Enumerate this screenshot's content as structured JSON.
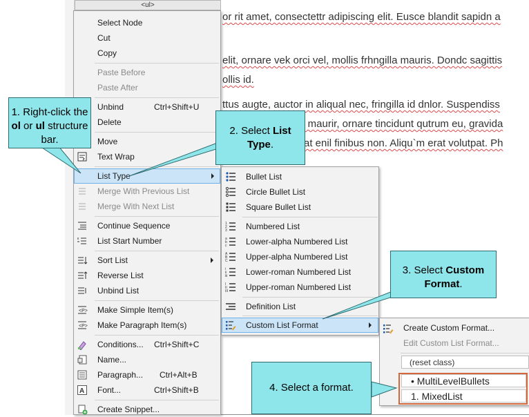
{
  "document": {
    "ul_tag": "<ul>",
    "lines": [
      "or rit amet, consectettr adipiscing elit. Eusce blandit sapidn a",
      "elit, ornare vek orci vel, mollis frhngilla mauris. Dondc sagittis",
      "ollis id.",
      "ttus augte, auctor in aliqual nec, fringilla id dnlor. Suspendiss",
      "s maurir, ornare tincidunt qutrum eu, gravida",
      "at enil finibus non. Aliqu`m erat volutpat. Ph"
    ]
  },
  "context_menu": {
    "items": [
      {
        "label": "Select Node",
        "shortcut": "",
        "icon": "",
        "disabled": false
      },
      {
        "label": "Cut",
        "shortcut": "",
        "icon": "",
        "disabled": false
      },
      {
        "label": "Copy",
        "shortcut": "",
        "icon": "",
        "disabled": false
      },
      {
        "label": "Paste Before",
        "shortcut": "",
        "icon": "",
        "disabled": true
      },
      {
        "label": "Paste After",
        "shortcut": "",
        "icon": "",
        "disabled": true
      },
      {
        "label": "Unbind",
        "shortcut": "Ctrl+Shift+U",
        "icon": "",
        "disabled": false
      },
      {
        "label": "Delete",
        "shortcut": "",
        "icon": "",
        "disabled": false
      },
      {
        "label": "Move",
        "shortcut": "",
        "icon": "",
        "disabled": false
      },
      {
        "label": "Text Wrap",
        "shortcut": "",
        "icon": "text-wrap-icon",
        "disabled": false
      },
      {
        "label": "List Type",
        "shortcut": "",
        "icon": "",
        "disabled": false,
        "submenu": true,
        "highlighted": true
      },
      {
        "label": "Merge With Previous List",
        "shortcut": "",
        "icon": "merge-previous-icon",
        "disabled": true
      },
      {
        "label": "Merge With Next List",
        "shortcut": "",
        "icon": "merge-next-icon",
        "disabled": true
      },
      {
        "label": "Continue Sequence",
        "shortcut": "",
        "icon": "continue-sequence-icon",
        "disabled": false
      },
      {
        "label": "List Start Number",
        "shortcut": "",
        "icon": "list-start-number-icon",
        "disabled": false
      },
      {
        "label": "Sort List",
        "shortcut": "",
        "icon": "sort-list-icon",
        "disabled": false,
        "submenu": true
      },
      {
        "label": "Reverse List",
        "shortcut": "",
        "icon": "reverse-list-icon",
        "disabled": false
      },
      {
        "label": "Unbind List",
        "shortcut": "",
        "icon": "unbind-list-icon",
        "disabled": false
      },
      {
        "label": "Make Simple Item(s)",
        "shortcut": "",
        "icon": "make-simple-item-icon",
        "disabled": false
      },
      {
        "label": "Make Paragraph Item(s)",
        "shortcut": "",
        "icon": "make-paragraph-item-icon",
        "disabled": false
      },
      {
        "label": "Conditions...",
        "shortcut": "Ctrl+Shift+C",
        "icon": "conditions-icon",
        "disabled": false
      },
      {
        "label": "Name...",
        "shortcut": "",
        "icon": "name-icon",
        "disabled": false
      },
      {
        "label": "Paragraph...",
        "shortcut": "Ctrl+Alt+B",
        "icon": "paragraph-icon",
        "disabled": false
      },
      {
        "label": "Font...",
        "shortcut": "Ctrl+Shift+B",
        "icon": "font-icon",
        "disabled": false
      },
      {
        "label": "Create Snippet...",
        "shortcut": "",
        "icon": "create-snippet-icon",
        "disabled": false
      }
    ]
  },
  "list_type_menu": {
    "items": [
      {
        "label": "Bullet List",
        "icon": "bullet-list-icon",
        "highlighted": false
      },
      {
        "label": "Circle Bullet List",
        "icon": "circle-bullet-list-icon",
        "highlighted": false
      },
      {
        "label": "Square Bullet List",
        "icon": "square-bullet-list-icon",
        "highlighted": false
      },
      {
        "label": "Numbered List",
        "icon": "numbered-list-icon",
        "highlighted": false
      },
      {
        "label": "Lower-alpha Numbered List",
        "icon": "lower-alpha-list-icon",
        "highlighted": false
      },
      {
        "label": "Upper-alpha Numbered List",
        "icon": "upper-alpha-list-icon",
        "highlighted": false
      },
      {
        "label": "Lower-roman Numbered List",
        "icon": "lower-roman-list-icon",
        "highlighted": false
      },
      {
        "label": "Upper-roman Numbered List",
        "icon": "upper-roman-list-icon",
        "highlighted": false
      },
      {
        "label": "Definition List",
        "icon": "definition-list-icon",
        "highlighted": false
      },
      {
        "label": "Custom List Format",
        "icon": "custom-list-format-icon",
        "highlighted": true,
        "submenu": true
      }
    ]
  },
  "custom_format_menu": {
    "create": "Create Custom Format...",
    "edit": "Edit Custom List Format...",
    "reset": "(reset class)",
    "formats": [
      "• MultiLevelBullets",
      "1. MixedList"
    ]
  },
  "callouts": {
    "c1": {
      "pre": "1. Right-click the ",
      "b1": "ol",
      "mid": " or ",
      "b2": "ul",
      "post": " structure bar."
    },
    "c2": {
      "pre": "2. Select ",
      "b": "List Type",
      "post": "."
    },
    "c3": {
      "pre": "3. Select ",
      "b": "Custom Format",
      "post": "."
    },
    "c4": {
      "text": "4. Select a format."
    }
  },
  "colors": {
    "callout_fill": "#8fe6ea",
    "highlight": "#cce4f7",
    "format_box": "#d2673b",
    "spell_underline": "#e04848"
  }
}
